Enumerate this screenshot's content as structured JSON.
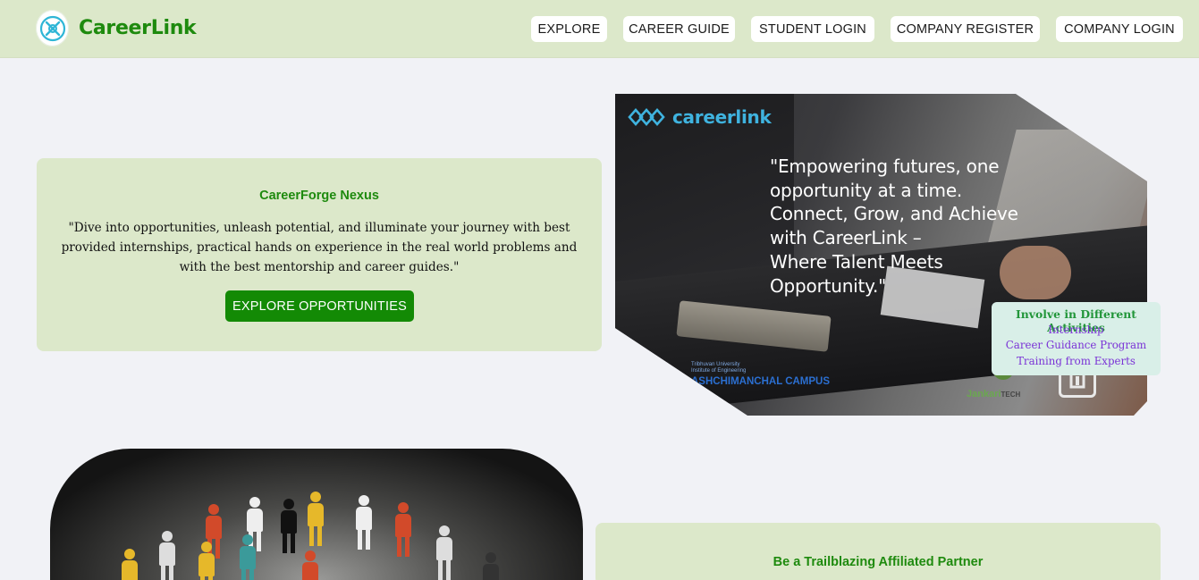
{
  "brand": {
    "name": "CareerLink"
  },
  "nav": {
    "items": [
      {
        "label": "EXPLORE"
      },
      {
        "label": "CAREER GUIDE"
      },
      {
        "label": "STUDENT LOGIN"
      },
      {
        "label": "COMPANY REGISTER"
      },
      {
        "label": "COMPANY LOGIN"
      }
    ]
  },
  "hero": {
    "title": "CareerForge Nexus",
    "text": "\"Dive into opportunities, unleash potential, and illuminate your journey with best provided internships, practical hands on experience in the real world problems and with the best mentorship and career guides.\"",
    "button_label": "EXPLORE OPPORTUNITIES"
  },
  "banner": {
    "logo_text": "careerlink",
    "quote": "\"Empowering futures, one\nopportunity at a time.\n Connect, Grow, and Achieve\nwith CareerLink –\nWhere Talent Meets\nOpportunity.\"",
    "campus_label": "ASHCHIMANCHAL CAMPUS",
    "campus_small": "Tribhuvan University\nInstitute of Engineering",
    "partner_label": "Jankari",
    "partner_suffix": "TECH"
  },
  "activities": {
    "title": "Involve in Different Activities",
    "items": [
      "Internship",
      "Career Guidance Program",
      "Training from Experts"
    ]
  },
  "partner": {
    "title": "Be a Trailblazing Affiliated Partner"
  },
  "colors": {
    "brand_green": "#1e8a0e",
    "nav_bg": "#dce8ca",
    "button_green": "#138a05",
    "activity_purple": "#7a33d6"
  }
}
